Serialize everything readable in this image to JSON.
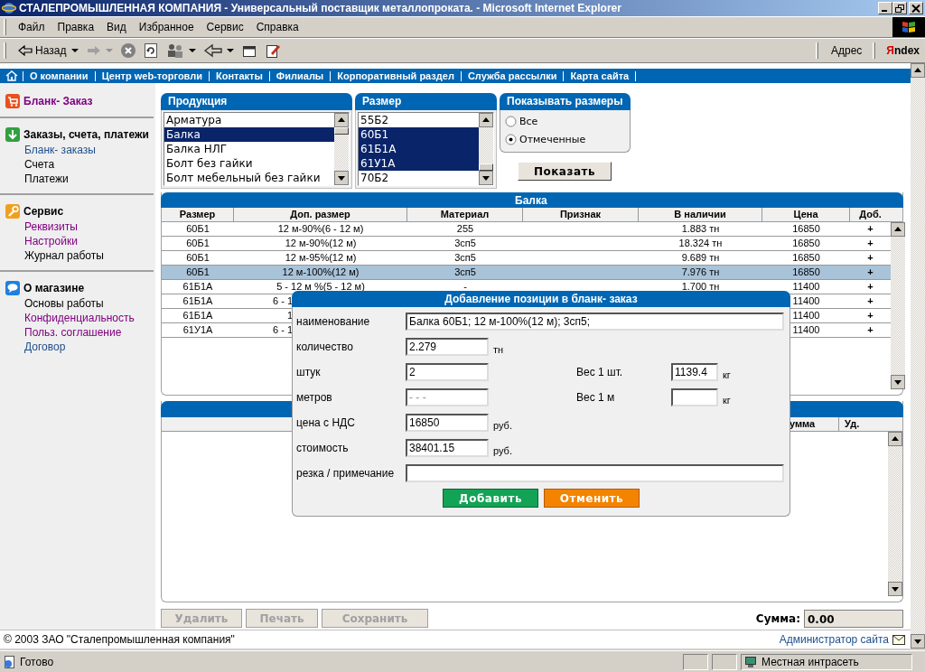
{
  "window": {
    "title": "СТАЛЕПРОМЫШЛЕННАЯ КОМПАНИЯ - Универсальный поставщик металлопроката. - Microsoft Internet Explorer"
  },
  "menu": [
    "Файл",
    "Правка",
    "Вид",
    "Избранное",
    "Сервис",
    "Справка"
  ],
  "toolbar": {
    "back": "Назад",
    "address": "Адрес",
    "search": "Яndex"
  },
  "nav": [
    "О компании",
    "Центр web-торговли",
    "Контакты",
    "Филиалы",
    "Корпоративный раздел",
    "Служба рассылки",
    "Карта сайта"
  ],
  "sidebar": {
    "sections": [
      {
        "kind": "cart",
        "title": "Бланк- Заказ",
        "visited": true
      },
      {
        "kind": "download",
        "title": "Заказы, счета, платежи",
        "visited": false,
        "items": [
          {
            "label": "Бланк- заказы",
            "kind": "link"
          },
          {
            "label": "Счета",
            "kind": "text"
          },
          {
            "label": "Платежи",
            "kind": "text"
          }
        ]
      },
      {
        "kind": "wrench",
        "title": "Сервис",
        "visited": false,
        "items": [
          {
            "label": "Реквизиты",
            "kind": "visited"
          },
          {
            "label": "Настройки",
            "kind": "visited"
          },
          {
            "label": "Журнал работы",
            "kind": "text"
          }
        ]
      },
      {
        "kind": "chat",
        "title": "О магазине",
        "visited": false,
        "items": [
          {
            "label": "Основы работы",
            "kind": "text"
          },
          {
            "label": "Конфиденциальность",
            "kind": "visited"
          },
          {
            "label": "Польз. соглашение",
            "kind": "visited"
          },
          {
            "label": "Договор",
            "kind": "link"
          }
        ]
      }
    ]
  },
  "product_list": {
    "title": "Продукция",
    "items": [
      {
        "label": "Арматура",
        "selected": false
      },
      {
        "label": "Балка",
        "selected": true
      },
      {
        "label": "Балка НЛГ",
        "selected": false
      },
      {
        "label": "Болт без гайки",
        "selected": false
      },
      {
        "label": "Болт мебельный без гайки",
        "selected": false
      }
    ]
  },
  "size_list": {
    "title": "Размер",
    "items": [
      {
        "label": "55Б2",
        "selected": false
      },
      {
        "label": "60Б1",
        "selected": true
      },
      {
        "label": "61Б1А",
        "selected": true
      },
      {
        "label": "61У1А",
        "selected": true
      },
      {
        "label": "70Б2",
        "selected": false
      }
    ]
  },
  "size_filter": {
    "title": "Показывать размеры",
    "options": [
      {
        "label": "Все",
        "selected": false
      },
      {
        "label": "Отмеченные",
        "selected": true
      }
    ]
  },
  "show_button": "Показать",
  "stock_table": {
    "title": "Балка",
    "columns": [
      "Размер",
      "Доп. размер",
      "Материал",
      "Признак",
      "В наличии",
      "Цена",
      "Доб."
    ],
    "rows": [
      {
        "size": "60Б1",
        "extra": "12 м-90%(6 - 12 м)",
        "material": "255",
        "stock": "1.883 тн",
        "price": "16850",
        "add": "+",
        "selected": false,
        "covered": false
      },
      {
        "size": "60Б1",
        "extra": "12 м-90%(12 м)",
        "material": "3сп5",
        "stock": "18.324 тн",
        "price": "16850",
        "add": "+",
        "selected": false,
        "covered": false
      },
      {
        "size": "60Б1",
        "extra": "12 м-95%(12 м)",
        "material": "3сп5",
        "stock": "9.689 тн",
        "price": "16850",
        "add": "+",
        "selected": false,
        "covered": false
      },
      {
        "size": "60Б1",
        "extra": "12 м-100%(12 м)",
        "material": "3сп5",
        "stock": "7.976 тн",
        "price": "16850",
        "add": "+",
        "selected": true,
        "covered": false
      },
      {
        "size": "61Б1А",
        "extra": "5 - 12 м %(5 - 12 м)",
        "material": "-",
        "stock": "1.700 тн",
        "price": "11400",
        "add": "+",
        "selected": false,
        "covered": false
      },
      {
        "size": "61Б1А",
        "extra": "6 - 1",
        "price": "11400",
        "add": "+",
        "selected": false,
        "covered": true
      },
      {
        "size": "61Б1А",
        "extra": "1",
        "price": "11400",
        "add": "+",
        "selected": false,
        "covered": true
      },
      {
        "size": "61У1А",
        "extra": "6 - 1",
        "price": "11400",
        "add": "+",
        "selected": false,
        "covered": true
      }
    ]
  },
  "order_table": {
    "columns": [
      "умма",
      "Уд."
    ]
  },
  "actions": [
    {
      "label": "Удалить",
      "disabled": true
    },
    {
      "label": "Печать",
      "disabled": true
    },
    {
      "label": "Сохранить",
      "disabled": true
    }
  ],
  "total": {
    "label": "Сумма:",
    "value": "0.00"
  },
  "footer": {
    "copyright": "© 2003 ЗАО \"Сталепромышленная компания\"",
    "admin_link": "Администратор сайта"
  },
  "dialog": {
    "title": "Добавление позиции в бланк- заказ",
    "rows": [
      {
        "kind": "wide",
        "label": "наименование",
        "value": "Балка 60Б1; 12 м-100%(12 м); 3сп5;"
      },
      {
        "kind": "pair",
        "fields": [
          {
            "label": "количество",
            "value": "2.279",
            "unit": "тн"
          }
        ]
      },
      {
        "kind": "pair",
        "fields": [
          {
            "label": "штук",
            "value": "2"
          },
          {
            "label": "Вес 1 шт.",
            "value": "1139.4",
            "unit": "кг"
          }
        ]
      },
      {
        "kind": "pair",
        "fields": [
          {
            "label": "метров",
            "placeholder": "- - -"
          },
          {
            "label": "Вес 1 м",
            "unit": "кг"
          }
        ]
      },
      {
        "kind": "pair",
        "fields": [
          {
            "label": "цена с НДС",
            "value": "16850",
            "unit": "руб."
          }
        ]
      },
      {
        "kind": "pair",
        "fields": [
          {
            "label": "стоимость",
            "value": "38401.15",
            "unit": "руб."
          }
        ]
      },
      {
        "kind": "wide",
        "label": "резка / примечание"
      }
    ],
    "buttons": [
      {
        "label": "Добавить",
        "kind": "primary"
      },
      {
        "label": "Отменить",
        "kind": "cancel"
      }
    ]
  },
  "status_bar": {
    "text": "Готово",
    "zone": "Местная интрасеть"
  }
}
